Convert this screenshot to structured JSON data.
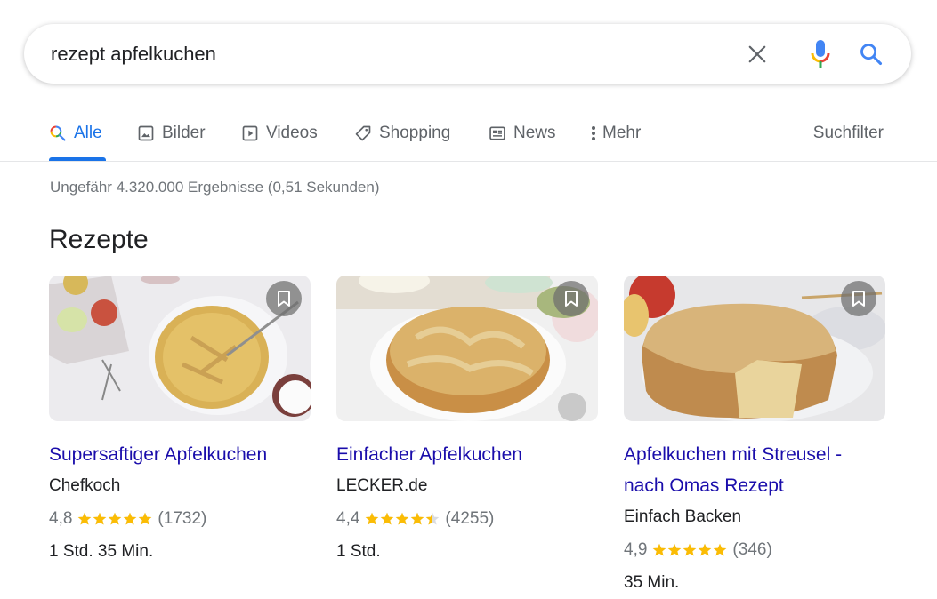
{
  "search": {
    "query": "rezept apfelkuchen",
    "clear_icon": "close-icon",
    "mic_icon": "microphone-icon",
    "search_icon": "search-icon"
  },
  "tabs": [
    {
      "label": "Alle",
      "icon": "search-icon",
      "active": true
    },
    {
      "label": "Bilder",
      "icon": "image-icon",
      "active": false
    },
    {
      "label": "Videos",
      "icon": "play-icon",
      "active": false
    },
    {
      "label": "Shopping",
      "icon": "tag-icon",
      "active": false
    },
    {
      "label": "News",
      "icon": "newspaper-icon",
      "active": false
    },
    {
      "label": "Mehr",
      "icon": "more-vert-icon",
      "active": false
    }
  ],
  "tools_label": "Suchfilter",
  "result_stats": "Ungefähr 4.320.000 Ergebnisse (0,51 Sekunden)",
  "section_title": "Rezepte",
  "colors": {
    "accent": "#1a73e8",
    "link": "#1a0dab",
    "star": "#fbbc04",
    "muted": "#70757a"
  },
  "recipes": [
    {
      "title": "Supersaftiger Apfelkuchen",
      "source": "Chefkoch",
      "rating": "4,8",
      "rating_value": 4.8,
      "reviews": "(1732)",
      "time": "1 Std. 35 Min.",
      "image_alt": "Apfelkuchen mit Tortenheber"
    },
    {
      "title": "Einfacher Apfelkuchen",
      "source": "LECKER.de",
      "rating": "4,4",
      "rating_value": 4.4,
      "reviews": "(4255)",
      "time": "1 Std.",
      "image_alt": "Einfacher Apfelkuchen auf Backpapier"
    },
    {
      "title": "Apfelkuchen mit Streusel - nach Omas Rezept",
      "source": "Einfach Backen",
      "rating": "4,9",
      "rating_value": 4.9,
      "reviews": "(346)",
      "time": "35 Min.",
      "image_alt": "Streuselkuchen mit Äpfeln"
    }
  ]
}
